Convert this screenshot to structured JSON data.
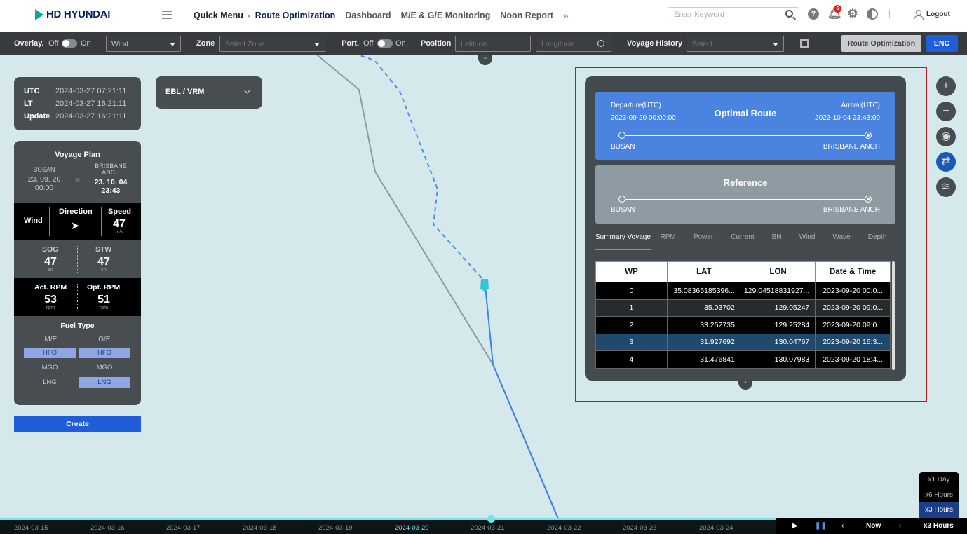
{
  "header": {
    "brand": "HD HYUNDAI",
    "quick_menu": "Quick Menu",
    "nav": [
      "Route Optimization",
      "Dashboard",
      "M/E & G/E Monitoring",
      "Noon Report"
    ],
    "search_placeholder": "Enter Keyword",
    "notification_count": "6",
    "logout": "Logout"
  },
  "toolbar": {
    "overlay_label": "Overlay.",
    "overlay_off": "Off",
    "overlay_on": "On",
    "overlay_select": "Wind",
    "zone_label": "Zone",
    "zone_placeholder": "Select Zone",
    "port_label": "Port.",
    "port_off": "Off",
    "port_on": "On",
    "position_label": "Position",
    "latitude_placeholder": "Latitude",
    "longitude_placeholder": "Longitude",
    "voyage_history_label": "Voyage History",
    "voyage_history_placeholder": "Select",
    "route_opt_button": "Route Optimization",
    "enc_button": "ENC"
  },
  "time_panel": {
    "rows": [
      {
        "key": "UTC",
        "value": "2024-03-27 07:21:11"
      },
      {
        "key": "LT",
        "value": "2024-03-27 16:21:11"
      },
      {
        "key": "Update",
        "value": "2024-03-27 16:21:11"
      }
    ]
  },
  "ebl": {
    "label": "EBL / VRM"
  },
  "voyage_plan": {
    "title": "Voyage Plan",
    "from_port": "BUSAN",
    "from_date": "23. 09. 20",
    "from_time": "00:00",
    "to_port_1": "BRISBANE",
    "to_port_2": "ANCH",
    "to_date": "23. 10. 04",
    "to_time": "23:43",
    "wind_label": "Wind",
    "direction_label": "Direction",
    "speed_label": "Speed",
    "wind_speed": "47",
    "wind_unit": "m/s",
    "sog_label": "SOG",
    "sog_value": "47",
    "sog_unit": "kn",
    "stw_label": "STW",
    "stw_value": "47",
    "stw_unit": "kn",
    "act_rpm_label": "Act. RPM",
    "act_rpm_value": "53",
    "act_rpm_unit": "rpm",
    "opt_rpm_label": "Opt. RPM",
    "opt_rpm_value": "51",
    "opt_rpm_unit": "rpm",
    "fuel_title": "Fuel Type",
    "me_label": "M/E",
    "ge_label": "G/E",
    "me_fuels": [
      {
        "name": "HFO",
        "selected": true
      },
      {
        "name": "MGO",
        "selected": false
      },
      {
        "name": "LNG",
        "selected": false
      }
    ],
    "ge_fuels": [
      {
        "name": "HFO",
        "selected": true
      },
      {
        "name": "MGO",
        "selected": false
      },
      {
        "name": "LNG",
        "selected": true
      }
    ],
    "create_button": "Create"
  },
  "route_panel": {
    "optimal": {
      "title": "Optimal Route",
      "departure_label": "Departure(UTC)",
      "departure_time": "2023-09-20 00:00:00",
      "arrival_label": "Arrival(UTC)",
      "arrival_time": "2023-10-04 23:43:00",
      "from": "BUSAN",
      "to": "BRISBANE ANCH"
    },
    "reference": {
      "title": "Reference",
      "from": "BUSAN",
      "to": "BRISBANE ANCH"
    },
    "tabs": [
      "Summary Voyage",
      "RPM",
      "Power",
      "Current",
      "BN",
      "Wind",
      "Wave",
      "Depth"
    ],
    "table": {
      "headers": [
        "WP",
        "LAT",
        "LON",
        "Date & Time"
      ],
      "rows": [
        {
          "wp": "0",
          "lat": "35.08365185396...",
          "lon": "129.04518831927...",
          "dt": "2023-09-20 00:0..."
        },
        {
          "wp": "1",
          "lat": "35.03702",
          "lon": "129.05247",
          "dt": "2023-09-20 09:0..."
        },
        {
          "wp": "2",
          "lat": "33.252735",
          "lon": "129.25284",
          "dt": "2023-09-20 09:0..."
        },
        {
          "wp": "3",
          "lat": "31.927692",
          "lon": "130.04767",
          "dt": "2023-09-20 16:3..."
        },
        {
          "wp": "4",
          "lat": "31.476841",
          "lon": "130.07983",
          "dt": "2023-09-20 18:4..."
        }
      ]
    }
  },
  "speed_options": [
    "x1 Day",
    "x6 Hours",
    "x3 Hours"
  ],
  "timeline": {
    "dates": [
      "2024-03-15",
      "2024-03-16",
      "2024-03-17",
      "2024-03-18",
      "2024-03-19",
      "2024-03-20",
      "2024-03-21",
      "2024-03-22",
      "2024-03-23",
      "2024-03-24"
    ],
    "current": "2024-03-20",
    "now_label": "Now",
    "speed_label": "x3 Hours"
  },
  "colors": {
    "brand_navy": "#0b1e5b",
    "accent_blue": "#1f5ed8",
    "optimal_card": "#4b84e0",
    "reference_card": "#8f9ba3",
    "timeline_cyan": "#6fe5ea",
    "highlight_red": "#b51c1c"
  }
}
